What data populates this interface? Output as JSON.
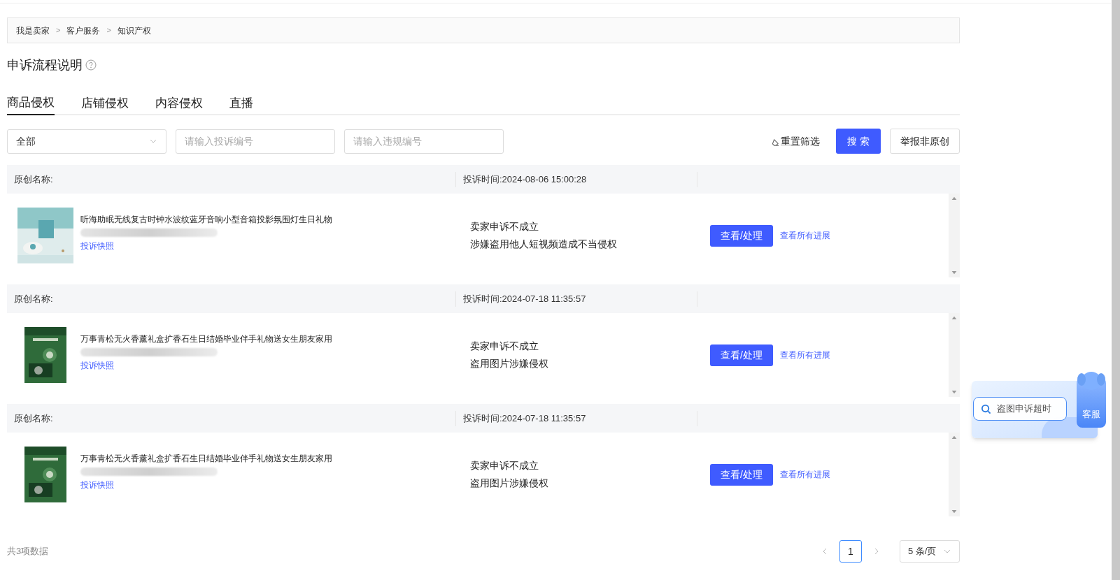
{
  "breadcrumb": {
    "items": [
      "我是卖家",
      "客户服务",
      "知识产权"
    ],
    "separator": ">"
  },
  "title": "申诉流程说明",
  "tabs": [
    {
      "label": "商品侵权",
      "selected": true
    },
    {
      "label": "店铺侵权",
      "selected": false
    },
    {
      "label": "内容侵权",
      "selected": false
    },
    {
      "label": "直播",
      "selected": false
    }
  ],
  "filters": {
    "type_select": "全部",
    "complaint_no": {
      "placeholder": "请输入投诉编号"
    },
    "violation_no": {
      "placeholder": "请输入违规编号"
    },
    "reset": "重置筛选",
    "search_button": "搜 索",
    "report_button": "举报非原创"
  },
  "records": [
    {
      "name_label": "原创名称:",
      "time": "投诉时间:2024-08-06 15:00:28",
      "product": "听海助眠无线复古时钟水波纹蓝牙音响小型音箱投影氛围灯生日礼物",
      "snapshot_link": "投诉快照",
      "status": "卖家申诉不成立",
      "reason": "涉嫌盗用他人短视频造成不当侵权",
      "action_button": "查看/处理",
      "progress_link": "查看所有进展"
    },
    {
      "name_label": "原创名称:",
      "time": "投诉时间:2024-07-18 11:35:57",
      "product": "万事青松无火香薰礼盒扩香石生日结婚毕业伴手礼物送女生朋友家用",
      "snapshot_link": "投诉快照",
      "status": "卖家申诉不成立",
      "reason": "盗用图片涉嫌侵权",
      "action_button": "查看/处理",
      "progress_link": "查看所有进展"
    },
    {
      "name_label": "原创名称:",
      "time": "投诉时间:2024-07-18 11:35:57",
      "product": "万事青松无火香薰礼盒扩香石生日结婚毕业伴手礼物送女生朋友家用",
      "snapshot_link": "投诉快照",
      "status": "卖家申诉不成立",
      "reason": "盗用图片涉嫌侵权",
      "action_button": "查看/处理",
      "progress_link": "查看所有进展"
    }
  ],
  "pagination": {
    "total": "共3项数据",
    "pages": [
      {
        "label": "1",
        "selected": true
      }
    ],
    "page_size": "5 条/页"
  },
  "help_widget": {
    "search": "盗图申诉超时",
    "service": "客服"
  }
}
